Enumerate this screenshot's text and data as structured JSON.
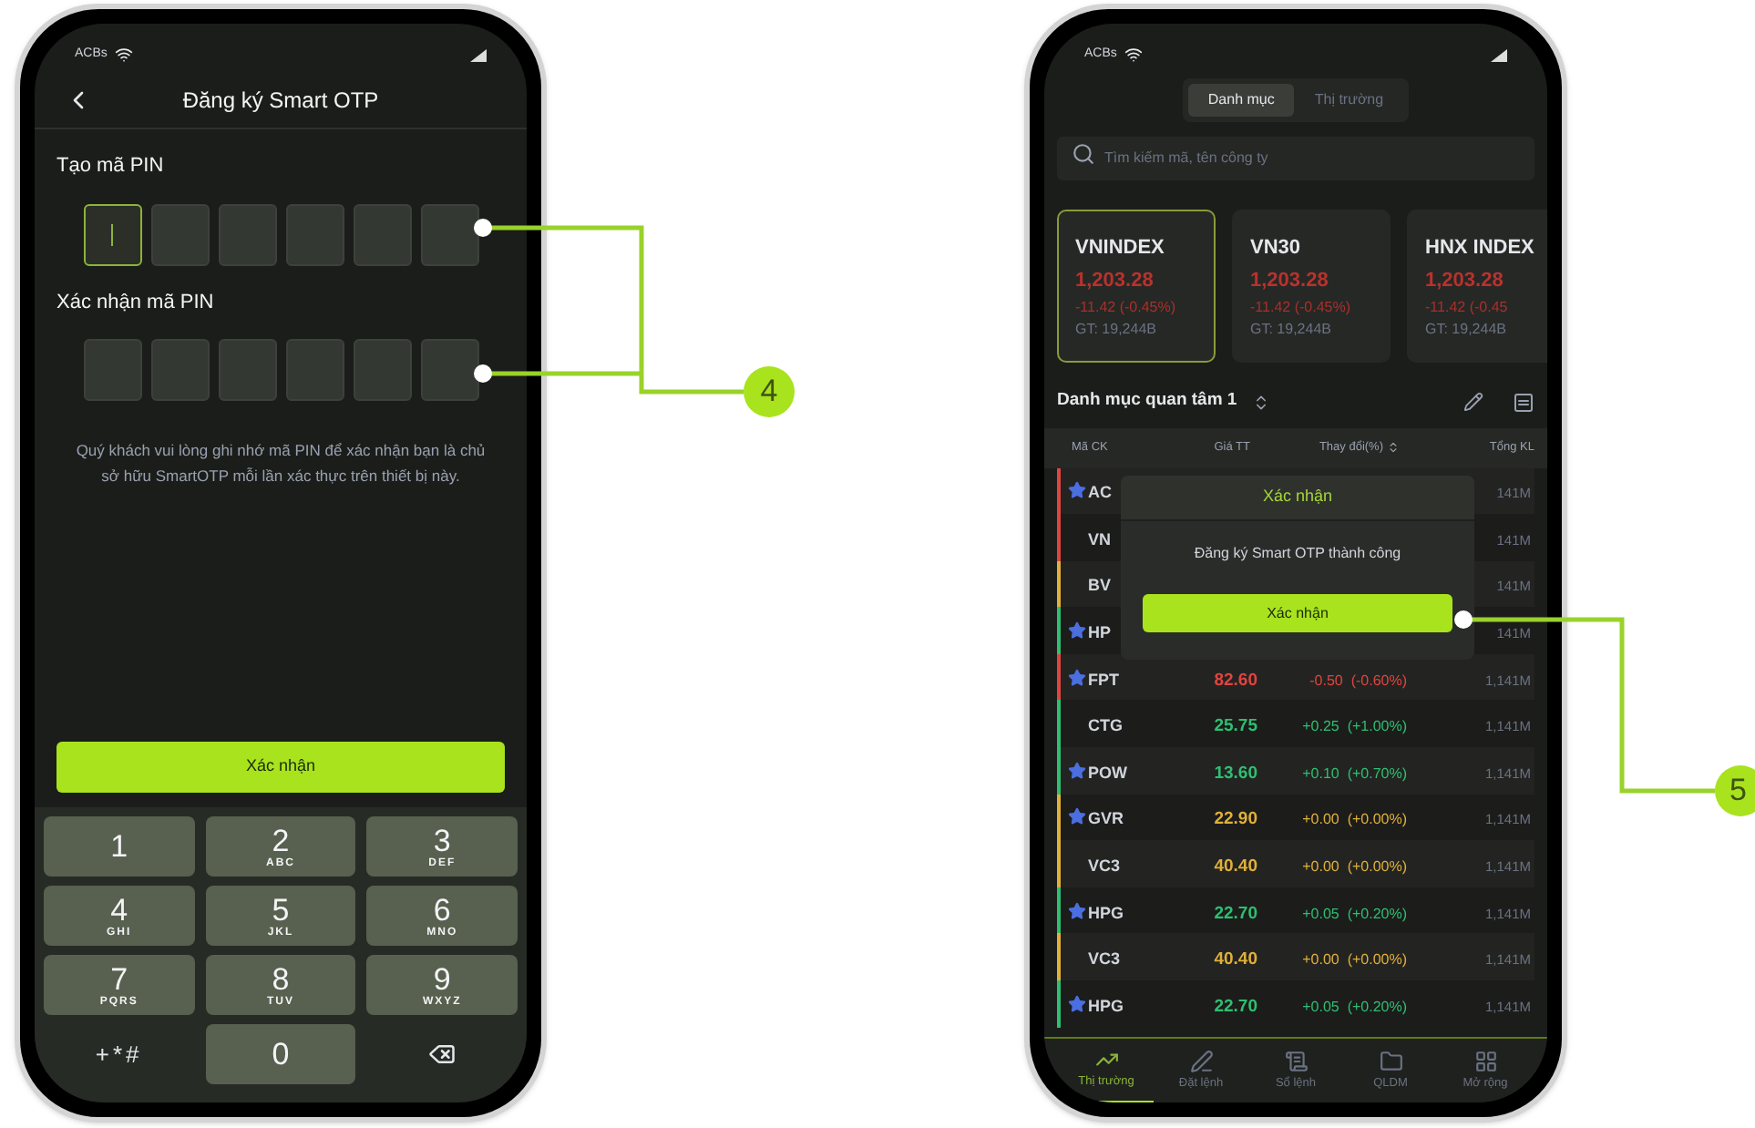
{
  "left_screen": {
    "status_bar": {
      "carrier": "ACBs"
    },
    "title": "Đăng ký Smart OTP",
    "pin_sections": [
      {
        "label": "Tạo mã PIN",
        "boxes": [
          {
            "focused": true
          },
          {
            "focused": false
          },
          {
            "focused": false
          },
          {
            "focused": false
          },
          {
            "focused": false
          },
          {
            "focused": false
          }
        ]
      },
      {
        "label": "Xác nhận mã PIN",
        "boxes": [
          {
            "focused": false
          },
          {
            "focused": false
          },
          {
            "focused": false
          },
          {
            "focused": false
          },
          {
            "focused": false
          },
          {
            "focused": false
          }
        ]
      }
    ],
    "note": "Quý khách vui lòng ghi nhớ mã PIN để xác nhận bạn là chủ sở hữu SmartOTP mỗi lần xác thực trên thiết bị này.",
    "confirm_button": "Xác nhận",
    "keypad": [
      {
        "kind": "digit",
        "digit": "1"
      },
      {
        "kind": "digit",
        "digit": "2",
        "letters": "ABC"
      },
      {
        "kind": "digit",
        "digit": "3",
        "letters": "DEF"
      },
      {
        "kind": "digit",
        "digit": "4",
        "letters": "GHI"
      },
      {
        "kind": "digit",
        "digit": "5",
        "letters": "JKL"
      },
      {
        "kind": "digit",
        "digit": "6",
        "letters": "MNO"
      },
      {
        "kind": "digit",
        "digit": "7",
        "letters": "PQRS"
      },
      {
        "kind": "digit",
        "digit": "8",
        "letters": "TUV"
      },
      {
        "kind": "digit",
        "digit": "9",
        "letters": "WXYZ"
      },
      {
        "kind": "symbols",
        "digit": "+*#"
      },
      {
        "kind": "digit",
        "digit": "0"
      },
      {
        "kind": "delete"
      }
    ]
  },
  "right_screen": {
    "status_bar": {
      "carrier": "ACBs"
    },
    "tabs": [
      {
        "label": "Danh mục",
        "selected": true
      },
      {
        "label": "Thị trường",
        "selected": false
      }
    ],
    "search": {
      "placeholder": "Tìm kiếm mã, tên công ty"
    },
    "index_cards": [
      {
        "name": "VNINDEX",
        "value": "1,203.28",
        "change": "-11.42 (-0.45%)",
        "turnover": "GT: 19,244B",
        "selected": true
      },
      {
        "name": "VN30",
        "value": "1,203.28",
        "change": "-11.42 (-0.45%)",
        "turnover": "GT: 19,244B",
        "selected": false
      },
      {
        "name": "HNX INDEX",
        "value": "1,203.28",
        "change": "-11.42 (-0.45",
        "turnover": "GT: 19,244B",
        "selected": false
      }
    ],
    "watchlist": {
      "name": "Danh mục quan tâm 1"
    },
    "columns": [
      "Mã CK",
      "Giá TT",
      "Thay đổi(%)",
      "Tổng KL"
    ],
    "rows": [
      {
        "symbol": "AC",
        "starred": true,
        "volume": "141M",
        "color": "#e0443e"
      },
      {
        "symbol": "VN",
        "starred": false,
        "volume": "141M",
        "color": "#e0443e"
      },
      {
        "symbol": "BV",
        "starred": false,
        "volume": "141M",
        "color": "#e0b03a"
      },
      {
        "symbol": "HP",
        "starred": true,
        "volume": "141M",
        "color": "#2fbf71"
      },
      {
        "symbol": "FPT",
        "starred": true,
        "price": "82.60",
        "change": "-0.50  (-0.60%)",
        "volume": "1,141M",
        "color": "#e0443e"
      },
      {
        "symbol": "CTG",
        "starred": false,
        "price": "25.75",
        "change": "+0.25  (+1.00%)",
        "volume": "1,141M",
        "color": "#2fbf71"
      },
      {
        "symbol": "POW",
        "starred": true,
        "price": "13.60",
        "change": "+0.10  (+0.70%)",
        "volume": "1,141M",
        "color": "#2fbf71"
      },
      {
        "symbol": "GVR",
        "starred": true,
        "price": "22.90",
        "change": "+0.00  (+0.00%)",
        "volume": "1,141M",
        "color": "#e0b03a"
      },
      {
        "symbol": "VC3",
        "starred": false,
        "price": "40.40",
        "change": "+0.00  (+0.00%)",
        "volume": "1,141M",
        "color": "#e0b03a"
      },
      {
        "symbol": "HPG",
        "starred": true,
        "price": "22.70",
        "change": "+0.05  (+0.20%)",
        "volume": "1,141M",
        "color": "#2fbf71"
      },
      {
        "symbol": "VC3",
        "starred": false,
        "price": "40.40",
        "change": "+0.00  (+0.00%)",
        "volume": "1,141M",
        "color": "#e0b03a"
      },
      {
        "symbol": "HPG",
        "starred": true,
        "price": "22.70",
        "change": "+0.05  (+0.20%)",
        "volume": "1,141M",
        "color": "#2fbf71"
      }
    ],
    "modal": {
      "title": "Xác nhận",
      "message": "Đăng ký Smart OTP thành công",
      "button": "Xác nhận"
    },
    "bottom_nav": [
      {
        "kind": "chart",
        "label": "Thị trường",
        "selected": true
      },
      {
        "kind": "order",
        "label": "Đặt lệnh",
        "selected": false
      },
      {
        "kind": "book",
        "label": "Sổ lệnh",
        "selected": false
      },
      {
        "kind": "folder",
        "label": "QLDM",
        "selected": false
      },
      {
        "kind": "grid",
        "label": "Mở rộng",
        "selected": false
      }
    ]
  },
  "callouts": [
    {
      "number": "4"
    },
    {
      "number": "5"
    }
  ]
}
